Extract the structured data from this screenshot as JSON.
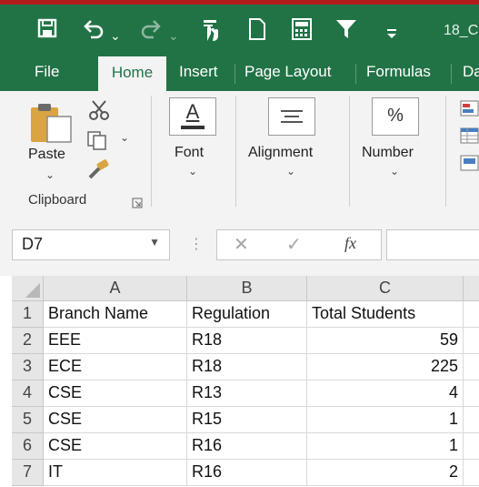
{
  "window": {
    "filename": "18_C"
  },
  "colors": {
    "ribbon_green": "#217346",
    "accent_red": "#b31b1b"
  },
  "quick_access": {
    "icons": [
      "save-icon",
      "undo-icon",
      "redo-icon",
      "touch-mode-icon",
      "new-document-icon",
      "calculator-icon",
      "filter-icon",
      "customize-qat-icon"
    ]
  },
  "tabs": [
    "File",
    "Home",
    "Insert",
    "Page Layout",
    "Formulas",
    "Da"
  ],
  "active_tab": "Home",
  "ribbon": {
    "clipboard": {
      "paste_label": "Paste",
      "group_label": "Clipboard"
    },
    "font_label": "Font",
    "alignment_label": "Alignment",
    "number_label": "Number"
  },
  "formula_bar": {
    "name_box": "D7",
    "formula_value": ""
  },
  "sheet": {
    "columns": [
      "A",
      "B",
      "C"
    ],
    "rows": [
      {
        "num": "1",
        "cells": [
          "Branch Name",
          "Regulation",
          "Total Students"
        ]
      },
      {
        "num": "2",
        "cells": [
          "EEE",
          "R18",
          "59"
        ]
      },
      {
        "num": "3",
        "cells": [
          "ECE",
          "R18",
          "225"
        ]
      },
      {
        "num": "4",
        "cells": [
          "CSE",
          "R13",
          "4"
        ]
      },
      {
        "num": "5",
        "cells": [
          "CSE",
          "R15",
          "1"
        ]
      },
      {
        "num": "6",
        "cells": [
          "CSE",
          "R16",
          "1"
        ]
      },
      {
        "num": "7",
        "cells": [
          "IT",
          "R16",
          "2"
        ]
      }
    ]
  }
}
